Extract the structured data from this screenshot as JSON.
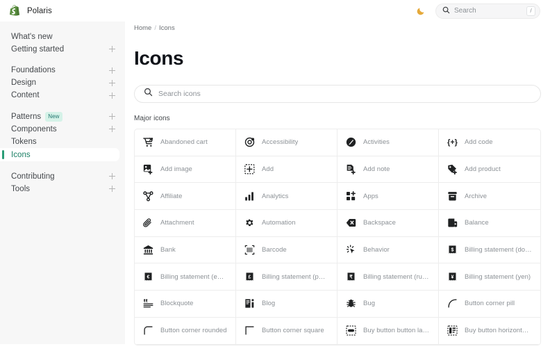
{
  "topbar": {
    "brand_name": "Polaris",
    "brand_logo_icon": "shopify-bag-icon",
    "theme_toggle_icon": "moon-icon",
    "search": {
      "placeholder": "Search",
      "shortcut": "/",
      "search_icon": "search-icon"
    }
  },
  "sidebar": {
    "groups": [
      {
        "items": [
          {
            "label": "What's new",
            "expandable": false,
            "selected": false
          },
          {
            "label": "Getting started",
            "expandable": true,
            "selected": false
          }
        ]
      },
      {
        "items": [
          {
            "label": "Foundations",
            "expandable": true,
            "selected": false
          },
          {
            "label": "Design",
            "expandable": true,
            "selected": false
          },
          {
            "label": "Content",
            "expandable": true,
            "selected": false
          }
        ]
      },
      {
        "items": [
          {
            "label": "Patterns",
            "badge": "New",
            "expandable": true,
            "selected": false
          },
          {
            "label": "Components",
            "expandable": true,
            "selected": false
          },
          {
            "label": "Tokens",
            "expandable": false,
            "selected": false
          },
          {
            "label": "Icons",
            "expandable": false,
            "selected": true
          }
        ]
      },
      {
        "items": [
          {
            "label": "Contributing",
            "expandable": true,
            "selected": false
          },
          {
            "label": "Tools",
            "expandable": true,
            "selected": false
          }
        ]
      }
    ]
  },
  "main": {
    "breadcrumb": {
      "home": "Home",
      "separator": "/",
      "current": "Icons"
    },
    "page_title": "Icons",
    "search": {
      "placeholder": "Search icons",
      "search_icon": "search-icon"
    },
    "section_title": "Major icons",
    "icons": [
      {
        "label": "Abandoned cart",
        "icon": "abandoned-cart-icon"
      },
      {
        "label": "Accessibility",
        "icon": "accessibility-icon"
      },
      {
        "label": "Activities",
        "icon": "activities-icon"
      },
      {
        "label": "Add code",
        "icon": "add-code-icon"
      },
      {
        "label": "Add image",
        "icon": "add-image-icon"
      },
      {
        "label": "Add",
        "icon": "add-icon"
      },
      {
        "label": "Add note",
        "icon": "add-note-icon"
      },
      {
        "label": "Add product",
        "icon": "add-product-icon"
      },
      {
        "label": "Affiliate",
        "icon": "affiliate-icon"
      },
      {
        "label": "Analytics",
        "icon": "analytics-icon"
      },
      {
        "label": "Apps",
        "icon": "apps-icon"
      },
      {
        "label": "Archive",
        "icon": "archive-icon"
      },
      {
        "label": "Attachment",
        "icon": "attachment-icon"
      },
      {
        "label": "Automation",
        "icon": "automation-icon"
      },
      {
        "label": "Backspace",
        "icon": "backspace-icon"
      },
      {
        "label": "Balance",
        "icon": "balance-icon"
      },
      {
        "label": "Bank",
        "icon": "bank-icon"
      },
      {
        "label": "Barcode",
        "icon": "barcode-icon"
      },
      {
        "label": "Behavior",
        "icon": "behavior-icon"
      },
      {
        "label": "Billing statement (dollar)",
        "icon": "billing-statement-dollar-icon"
      },
      {
        "label": "Billing statement (euro)",
        "icon": "billing-statement-euro-icon"
      },
      {
        "label": "Billing statement (poun...",
        "icon": "billing-statement-pound-icon"
      },
      {
        "label": "Billing statement (rupee)",
        "icon": "billing-statement-rupee-icon"
      },
      {
        "label": "Billing statement (yen)",
        "icon": "billing-statement-yen-icon"
      },
      {
        "label": "Blockquote",
        "icon": "blockquote-icon"
      },
      {
        "label": "Blog",
        "icon": "blog-icon"
      },
      {
        "label": "Bug",
        "icon": "bug-icon"
      },
      {
        "label": "Button corner pill",
        "icon": "button-corner-pill-icon"
      },
      {
        "label": "Button corner rounded",
        "icon": "button-corner-rounded-icon"
      },
      {
        "label": "Button corner square",
        "icon": "button-corner-square-icon"
      },
      {
        "label": "Buy button button layout",
        "icon": "buy-button-button-layout-icon"
      },
      {
        "label": "Buy button horizontal l...",
        "icon": "buy-button-horizontal-layout-icon"
      }
    ]
  },
  "colors": {
    "brand_green": "#5a8e3f",
    "accent_teal": "#1a7f64",
    "selection_bar": "#2a9d76",
    "badge_bg": "#d5f2e8",
    "badge_text": "#22756f",
    "sidebar_bg": "#f7f7f7",
    "border": "#ededed",
    "text_primary": "#202223",
    "text_muted": "#8c9196"
  }
}
